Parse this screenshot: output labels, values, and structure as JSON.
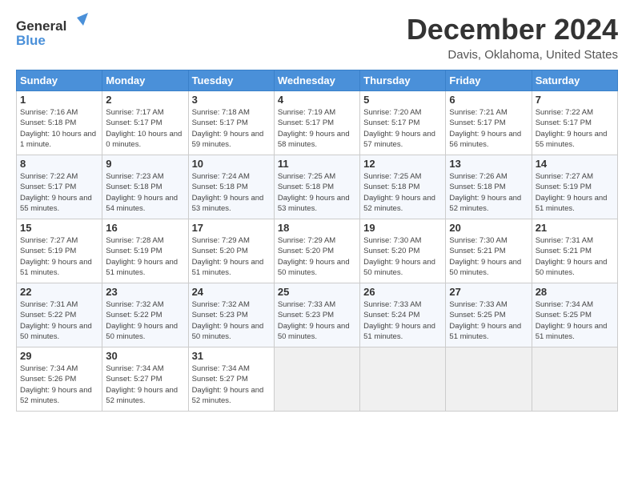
{
  "header": {
    "logo_general": "General",
    "logo_blue": "Blue",
    "title": "December 2024",
    "subtitle": "Davis, Oklahoma, United States"
  },
  "calendar": {
    "days_of_week": [
      "Sunday",
      "Monday",
      "Tuesday",
      "Wednesday",
      "Thursday",
      "Friday",
      "Saturday"
    ],
    "weeks": [
      [
        {
          "day": "1",
          "sunrise": "7:16 AM",
          "sunset": "5:18 PM",
          "daylight": "10 hours and 1 minute."
        },
        {
          "day": "2",
          "sunrise": "7:17 AM",
          "sunset": "5:17 PM",
          "daylight": "10 hours and 0 minutes."
        },
        {
          "day": "3",
          "sunrise": "7:18 AM",
          "sunset": "5:17 PM",
          "daylight": "9 hours and 59 minutes."
        },
        {
          "day": "4",
          "sunrise": "7:19 AM",
          "sunset": "5:17 PM",
          "daylight": "9 hours and 58 minutes."
        },
        {
          "day": "5",
          "sunrise": "7:20 AM",
          "sunset": "5:17 PM",
          "daylight": "9 hours and 57 minutes."
        },
        {
          "day": "6",
          "sunrise": "7:21 AM",
          "sunset": "5:17 PM",
          "daylight": "9 hours and 56 minutes."
        },
        {
          "day": "7",
          "sunrise": "7:22 AM",
          "sunset": "5:17 PM",
          "daylight": "9 hours and 55 minutes."
        }
      ],
      [
        {
          "day": "8",
          "sunrise": "7:22 AM",
          "sunset": "5:17 PM",
          "daylight": "9 hours and 55 minutes."
        },
        {
          "day": "9",
          "sunrise": "7:23 AM",
          "sunset": "5:18 PM",
          "daylight": "9 hours and 54 minutes."
        },
        {
          "day": "10",
          "sunrise": "7:24 AM",
          "sunset": "5:18 PM",
          "daylight": "9 hours and 53 minutes."
        },
        {
          "day": "11",
          "sunrise": "7:25 AM",
          "sunset": "5:18 PM",
          "daylight": "9 hours and 53 minutes."
        },
        {
          "day": "12",
          "sunrise": "7:25 AM",
          "sunset": "5:18 PM",
          "daylight": "9 hours and 52 minutes."
        },
        {
          "day": "13",
          "sunrise": "7:26 AM",
          "sunset": "5:18 PM",
          "daylight": "9 hours and 52 minutes."
        },
        {
          "day": "14",
          "sunrise": "7:27 AM",
          "sunset": "5:19 PM",
          "daylight": "9 hours and 51 minutes."
        }
      ],
      [
        {
          "day": "15",
          "sunrise": "7:27 AM",
          "sunset": "5:19 PM",
          "daylight": "9 hours and 51 minutes."
        },
        {
          "day": "16",
          "sunrise": "7:28 AM",
          "sunset": "5:19 PM",
          "daylight": "9 hours and 51 minutes."
        },
        {
          "day": "17",
          "sunrise": "7:29 AM",
          "sunset": "5:20 PM",
          "daylight": "9 hours and 51 minutes."
        },
        {
          "day": "18",
          "sunrise": "7:29 AM",
          "sunset": "5:20 PM",
          "daylight": "9 hours and 50 minutes."
        },
        {
          "day": "19",
          "sunrise": "7:30 AM",
          "sunset": "5:20 PM",
          "daylight": "9 hours and 50 minutes."
        },
        {
          "day": "20",
          "sunrise": "7:30 AM",
          "sunset": "5:21 PM",
          "daylight": "9 hours and 50 minutes."
        },
        {
          "day": "21",
          "sunrise": "7:31 AM",
          "sunset": "5:21 PM",
          "daylight": "9 hours and 50 minutes."
        }
      ],
      [
        {
          "day": "22",
          "sunrise": "7:31 AM",
          "sunset": "5:22 PM",
          "daylight": "9 hours and 50 minutes."
        },
        {
          "day": "23",
          "sunrise": "7:32 AM",
          "sunset": "5:22 PM",
          "daylight": "9 hours and 50 minutes."
        },
        {
          "day": "24",
          "sunrise": "7:32 AM",
          "sunset": "5:23 PM",
          "daylight": "9 hours and 50 minutes."
        },
        {
          "day": "25",
          "sunrise": "7:33 AM",
          "sunset": "5:23 PM",
          "daylight": "9 hours and 50 minutes."
        },
        {
          "day": "26",
          "sunrise": "7:33 AM",
          "sunset": "5:24 PM",
          "daylight": "9 hours and 51 minutes."
        },
        {
          "day": "27",
          "sunrise": "7:33 AM",
          "sunset": "5:25 PM",
          "daylight": "9 hours and 51 minutes."
        },
        {
          "day": "28",
          "sunrise": "7:34 AM",
          "sunset": "5:25 PM",
          "daylight": "9 hours and 51 minutes."
        }
      ],
      [
        {
          "day": "29",
          "sunrise": "7:34 AM",
          "sunset": "5:26 PM",
          "daylight": "9 hours and 52 minutes."
        },
        {
          "day": "30",
          "sunrise": "7:34 AM",
          "sunset": "5:27 PM",
          "daylight": "9 hours and 52 minutes."
        },
        {
          "day": "31",
          "sunrise": "7:34 AM",
          "sunset": "5:27 PM",
          "daylight": "9 hours and 52 minutes."
        },
        null,
        null,
        null,
        null
      ]
    ]
  }
}
